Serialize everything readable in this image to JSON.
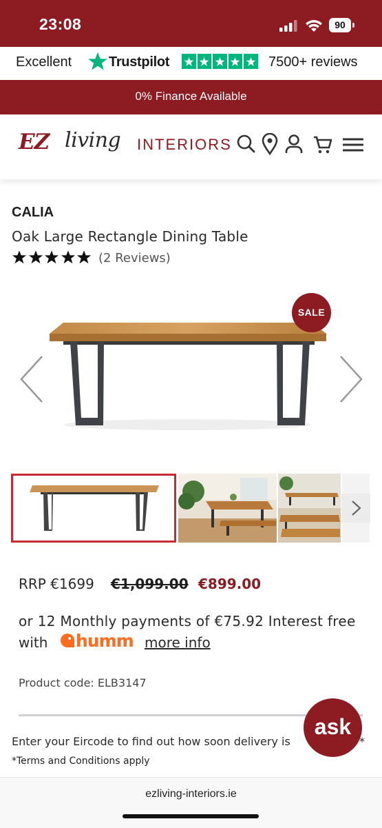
{
  "status_bar": {
    "time": "23:08",
    "battery": "90"
  },
  "trustpilot": {
    "rating_word": "Excellent",
    "brand": "Trustpilot",
    "reviews": "7500+ reviews"
  },
  "finance_banner": "0% Finance Available",
  "header": {
    "logo_ez": "EZ",
    "logo_living": "living",
    "logo_interiors": "INTERIORS",
    "icons": [
      "search-icon",
      "location-icon",
      "account-icon",
      "cart-icon",
      "menu-icon"
    ]
  },
  "product": {
    "brand": "CALIA",
    "name": "Oak Large Rectangle Dining Table",
    "stars": 5,
    "reviews": "(2 Reviews)",
    "sale_badge": "SALE",
    "rrp": "RRP €1699",
    "old_price": "€1,099.00",
    "sale_price": "€899.00",
    "monthly": "or 12 Monthly payments of €75.92 Interest free",
    "with": "with",
    "humm": "humm",
    "more_info": "more info",
    "code": "Product code: ELB3147"
  },
  "delivery": {
    "eircode_text": "Enter your Eircode to find out how soon delivery is",
    "eircode_tail": "*",
    "terms": "*Terms and Conditions apply"
  },
  "chat": {
    "label": "ask"
  },
  "browser": {
    "url": "ezliving-interiors.ie"
  },
  "colors": {
    "brand": "#8c1b22",
    "trustpilot_green": "#00b67a",
    "humm_orange": "#ff6c1f"
  }
}
